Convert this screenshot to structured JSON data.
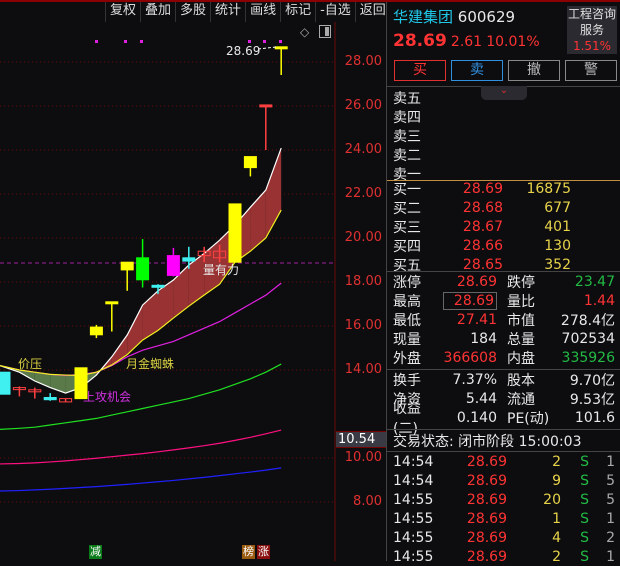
{
  "toolbar": [
    "复权",
    "叠加",
    "多股",
    "统计",
    "画线",
    "标记",
    "-自选",
    "返回"
  ],
  "axis": {
    "labels": [
      "28.00",
      "26.00",
      "24.00",
      "22.00",
      "20.00",
      "18.00",
      "16.00",
      "14.00",
      "10.00",
      "8.00"
    ],
    "ticks": [
      28,
      26,
      24,
      22,
      20,
      18,
      16,
      14,
      10,
      8
    ],
    "current": "10.54"
  },
  "annotations": {
    "last_price": "28.69",
    "jiaya": "价压",
    "yuejin": "月金蜘蛛",
    "shanggong": "上攻机会",
    "liangyouli": "量有力"
  },
  "bottom_tags": {
    "jian": "减",
    "bang": "榜",
    "zhang": "涨"
  },
  "candles": [
    [
      13.9,
      13.9,
      12.9,
      12.9,
      "cyan"
    ],
    [
      13.2,
      13.25,
      12.8,
      13.2,
      "red"
    ],
    [
      13.1,
      13.2,
      12.7,
      13.1,
      "red"
    ],
    [
      12.75,
      12.95,
      12.6,
      12.65,
      "cyan"
    ],
    [
      12.55,
      12.7,
      12.55,
      12.7,
      "red"
    ],
    [
      12.7,
      14.1,
      12.7,
      14.1,
      "yellow"
    ],
    [
      15.6,
      16.05,
      15.45,
      15.95,
      "yellow"
    ],
    [
      17.05,
      17.1,
      15.75,
      17.1,
      "yellow"
    ],
    [
      18.55,
      18.9,
      17.6,
      18.9,
      "yellow"
    ],
    [
      19.1,
      19.95,
      17.75,
      18.1,
      "lime"
    ],
    [
      17.85,
      17.9,
      17.45,
      17.85,
      "cyan"
    ],
    [
      19.2,
      19.55,
      18.25,
      18.3,
      "magenta"
    ],
    [
      19.1,
      19.6,
      18.6,
      18.95,
      "cyan"
    ],
    [
      19.2,
      19.6,
      18.9,
      19.4,
      "red"
    ],
    [
      19.1,
      19.7,
      18.9,
      19.4,
      "red"
    ],
    [
      18.9,
      21.55,
      18.9,
      21.55,
      "yellow"
    ],
    [
      23.2,
      23.7,
      22.8,
      23.7,
      "yellow"
    ],
    [
      26.05,
      26.05,
      24.0,
      26.05,
      "red"
    ],
    [
      28.69,
      28.69,
      27.41,
      28.6,
      "yellow"
    ]
  ],
  "lines": {
    "upper": [
      14.2,
      13.9,
      13.5,
      13.2,
      12.95,
      13.2,
      13.77,
      14.6,
      15.59,
      16.95,
      17.6,
      18.09,
      18.77,
      19.3,
      19.9,
      20.59,
      21.4,
      22.18,
      24.09
    ],
    "lower": [
      14.2,
      14.0,
      13.9,
      13.8,
      13.77,
      13.75,
      13.9,
      14.23,
      14.7,
      15.36,
      15.8,
      16.36,
      16.9,
      17.41,
      17.9,
      18.9,
      19.4,
      20.0,
      21.27
    ],
    "magenta": [
      14.2,
      14.0,
      13.9,
      13.8,
      13.75,
      13.8,
      13.9,
      14.2,
      14.6,
      14.9,
      15.1,
      15.3,
      15.6,
      15.9,
      16.2,
      16.6,
      17.0,
      17.4,
      17.95
    ],
    "green": [
      11.3,
      11.35,
      11.4,
      11.5,
      11.6,
      11.7,
      11.8,
      11.95,
      12.1,
      12.25,
      12.4,
      12.55,
      12.7,
      12.9,
      13.1,
      13.35,
      13.6,
      13.9,
      14.27
    ],
    "pink": [
      9.73,
      9.75,
      9.78,
      9.82,
      9.87,
      9.93,
      9.99,
      10.06,
      10.13,
      10.2,
      10.28,
      10.37,
      10.46,
      10.56,
      10.67,
      10.8,
      10.94,
      11.1,
      11.27
    ],
    "blue": [
      8.5,
      8.52,
      8.55,
      8.58,
      8.62,
      8.66,
      8.7,
      8.75,
      8.8,
      8.86,
      8.92,
      8.98,
      9.05,
      9.12,
      9.2,
      9.28,
      9.36,
      9.45,
      9.55
    ]
  },
  "stock": {
    "name": "华建集团",
    "code": "600629",
    "price": "28.69",
    "change": "2.61",
    "pct": "10.01%",
    "sector": "工程咨询",
    "sector2": "服务",
    "sector_pct": "1.51%"
  },
  "actions": {
    "buy": "买",
    "sell": "卖",
    "cancel": "撤",
    "alert": "警"
  },
  "asks": [
    "卖五",
    "卖四",
    "卖三",
    "卖二",
    "卖一"
  ],
  "bids": [
    [
      "买一",
      "28.69",
      "16875"
    ],
    [
      "买二",
      "28.68",
      "677"
    ],
    [
      "买三",
      "28.67",
      "401"
    ],
    [
      "买四",
      "28.66",
      "130"
    ],
    [
      "买五",
      "28.65",
      "352"
    ]
  ],
  "stats": [
    [
      "涨停",
      "28.69",
      "跌停",
      "23.47"
    ],
    [
      "最高",
      "28.69",
      "量比",
      "1.44"
    ],
    [
      "最低",
      "27.41",
      "市值",
      "278.4亿"
    ],
    [
      "现量",
      "184",
      "总量",
      "702534"
    ],
    [
      "外盘",
      "366608",
      "内盘",
      "335926"
    ]
  ],
  "stats2": [
    [
      "换手",
      "7.37%",
      "股本",
      "9.70亿"
    ],
    [
      "净资",
      "5.44",
      "流通",
      "9.53亿"
    ],
    [
      "收益(二)",
      "0.140",
      "PE(动)",
      "101.6"
    ]
  ],
  "status": "交易状态: 闭市阶段 15:00:03",
  "trades": [
    [
      "14:54",
      "28.69",
      "2",
      "S",
      "1"
    ],
    [
      "14:54",
      "28.69",
      "9",
      "S",
      "5"
    ],
    [
      "14:55",
      "28.69",
      "20",
      "S",
      "5"
    ],
    [
      "14:55",
      "28.69",
      "1",
      "S",
      "1"
    ],
    [
      "14:55",
      "28.69",
      "4",
      "S",
      "2"
    ],
    [
      "14:55",
      "28.69",
      "2",
      "S",
      "1"
    ]
  ]
}
